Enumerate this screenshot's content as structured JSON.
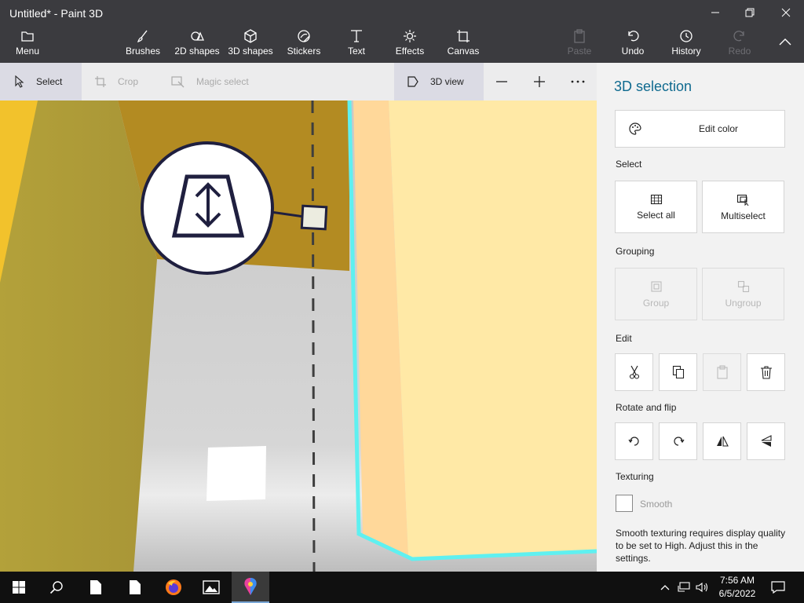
{
  "window": {
    "title": "Untitled* - Paint 3D"
  },
  "ribbon": {
    "menu": "Menu",
    "brushes": "Brushes",
    "shapes_2d": "2D shapes",
    "shapes_3d": "3D shapes",
    "stickers": "Stickers",
    "text": "Text",
    "effects": "Effects",
    "canvas": "Canvas",
    "paste": "Paste",
    "undo": "Undo",
    "history": "History",
    "redo": "Redo"
  },
  "subtoolbar": {
    "select": "Select",
    "crop": "Crop",
    "magic_select": "Magic select",
    "view_3d": "3D view"
  },
  "panel": {
    "title": "3D selection",
    "edit_color": "Edit color",
    "select_heading": "Select",
    "select_all": "Select all",
    "multiselect": "Multiselect",
    "grouping_heading": "Grouping",
    "group": "Group",
    "ungroup": "Ungroup",
    "edit_heading": "Edit",
    "rotate_heading": "Rotate and flip",
    "texturing_heading": "Texturing",
    "smooth": "Smooth",
    "note": "Smooth texturing requires display quality to be set to High. Adjust this in the settings."
  },
  "taskbar": {
    "time": "7:56 AM",
    "date": "6/5/2022"
  },
  "colors": {
    "accent": "#0f6a8f",
    "selection": "#5ff0f0"
  }
}
